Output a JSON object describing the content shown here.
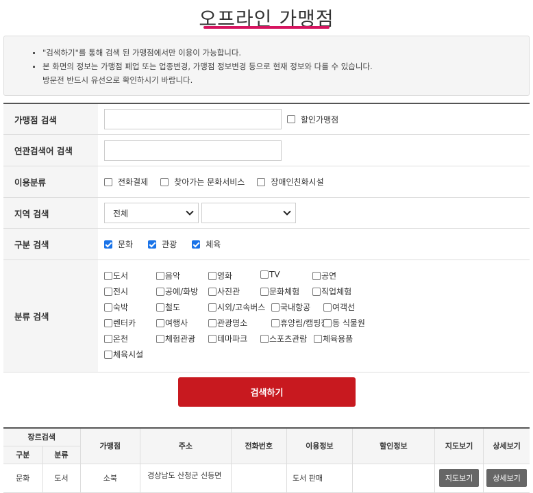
{
  "title": "오프라인 가맹점",
  "notice": {
    "line1": "\"검색하기\"를 통해 검색 된 가맹점에서만 이용이 가능합니다.",
    "line2": "본 화면의 정보는 가맹점 폐업 또는 업종변경, 가맹점 정보변경 등으로 현재 정보와 다를 수 있습니다.",
    "line3": "방문전 반드시 유선으로 확인하시기 바랍니다."
  },
  "form": {
    "store_search_label": "가맹점 검색",
    "store_search_value": "",
    "discount_store_label": "할인가맹점",
    "related_search_label": "연관검색어 검색",
    "related_search_value": "",
    "usage_label": "이용분류",
    "usage_options": [
      "전화결제",
      "찾아가는 문화서비스",
      "장애인친화시설"
    ],
    "region_label": "지역 검색",
    "region_select1": "전체",
    "region_select2": "",
    "division_label": "구분 검색",
    "division_options": [
      "문화",
      "관광",
      "체육"
    ],
    "category_label": "분류 검색",
    "categories": [
      "도서",
      "음악",
      "영화",
      "TV",
      "공연",
      "전시",
      "공예/화방",
      "사진관",
      "문화체험",
      "직업체험",
      "숙박",
      "철도",
      "시외/고속버스",
      "국내항공",
      "여객선",
      "렌터카",
      "여행사",
      "관광명소",
      "휴양림/캠핑장",
      "동 식물원",
      "온천",
      "체험관광",
      "테마파크",
      "스포츠관람",
      "체육용품",
      "체육시설"
    ]
  },
  "search_button": "검색하기",
  "results": {
    "header_group": "장르검색",
    "headers": {
      "division": "구분",
      "category": "분류",
      "store": "가맹점",
      "address": "주소",
      "phone": "전화번호",
      "usage_info": "이용정보",
      "discount_info": "할인정보",
      "map": "지도보기",
      "detail": "상세보기"
    },
    "rows": [
      {
        "division": "문화",
        "category": "도서",
        "store": "소북",
        "address": "경상남도 산청군 신등면",
        "phone": "",
        "usage_info": "도서 판매",
        "discount_info": "",
        "map_button": "지도보기",
        "detail_button": "상세보기"
      }
    ]
  },
  "colors": {
    "accent_underline": "#d6145f",
    "search_button": "#c8191f",
    "checkbox_checked": "#1a73e8",
    "row_button": "#666666"
  }
}
